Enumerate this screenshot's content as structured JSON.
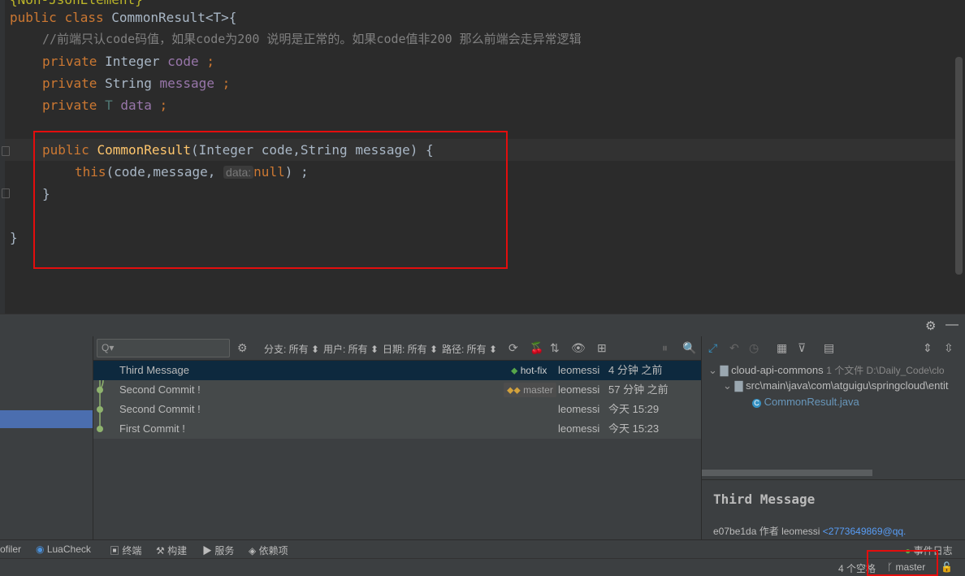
{
  "editor": {
    "line0": "{Non-JsonElement}",
    "class_kw1": "public",
    "class_kw2": "class",
    "class_name": "CommonResult",
    "class_generic": "<T>{",
    "comment": "//前端只认code码值，如果code为200 说明是正常的。如果code值非200 那么前端会走异常逻辑",
    "fields": [
      {
        "mod": "private",
        "type": "Integer",
        "name": "code",
        "semi": " ;"
      },
      {
        "mod": "private",
        "type": "String",
        "name": "message",
        "semi": " ;"
      },
      {
        "mod": "private",
        "type": "T",
        "name": "data",
        "semi": " ;"
      }
    ],
    "ctor_mod": "public",
    "ctor_name": "CommonResult",
    "ctor_params": "(Integer code,String message) {",
    "this_kw": "this",
    "this_args": "(code,message,",
    "hint": "data:",
    "null_kw": "null",
    "this_end": ") ;",
    "ctor_close": "}",
    "class_close": "}"
  },
  "log_toolbar": {
    "branch_filter": "分支: 所有 ⬍",
    "user_filter": "用户: 所有 ⬍",
    "date_filter": "日期: 所有 ⬍",
    "path_filter": "路径: 所有 ⬍",
    "search_placeholder": "Q▾"
  },
  "commits": [
    {
      "message": "Third Message",
      "tag": "hot-fix",
      "author": "leomessi",
      "date": "4 分钟 之前"
    },
    {
      "message": "Second Commit !",
      "tag": "master",
      "author": "leomessi",
      "date": "57 分钟 之前"
    },
    {
      "message": "Second Commit !",
      "tag": "",
      "author": "leomessi",
      "date": "今天 15:29"
    },
    {
      "message": "First Commit !",
      "tag": "",
      "author": "leomessi",
      "date": "今天 15:23"
    }
  ],
  "details": {
    "module": "cloud-api-commons",
    "module_meta": "1 个文件  D:\\Daily_Code\\clo",
    "path": "src\\main\\java\\com\\atguigu\\springcloud\\entit",
    "file": "CommonResult.java",
    "commit_title": "Third Message",
    "hash": "e07be1da",
    "author_label": "作者 leomessi",
    "email": "<2773649869@qq."
  },
  "bottom_toolbar": {
    "profiler": "ofiler",
    "luacheck": "LuaCheck",
    "terminal": "终端",
    "build": "构建",
    "services": "服务",
    "deps": "依赖项",
    "event_log": "事件日志"
  },
  "status": {
    "indent": "4 个空格",
    "branch": "master"
  },
  "colors": {
    "accent_red": "#e30d0d",
    "selection": "#4b6eaf",
    "graph_green": "#8fb36e"
  }
}
